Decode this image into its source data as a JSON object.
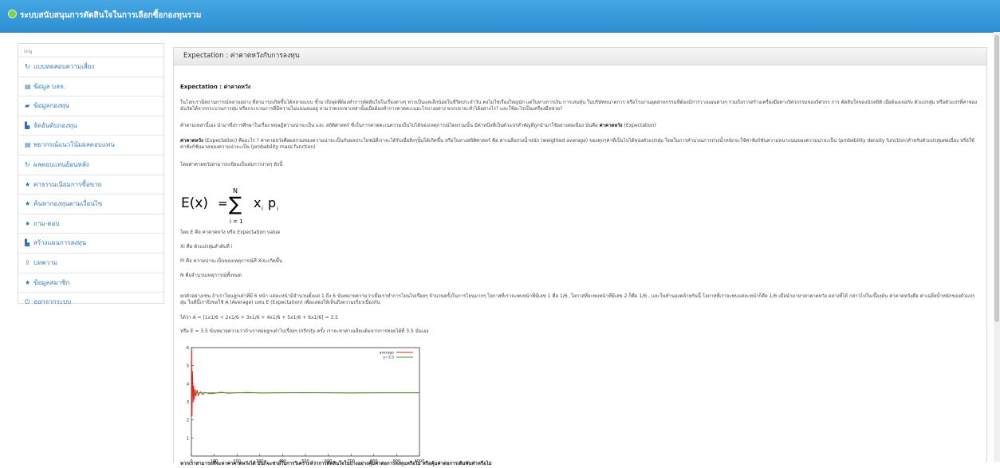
{
  "header": {
    "title": "ระบบสนับสนุนการตัดสินใจในการเลือกซื้อกองทุนรวม"
  },
  "sidebar": {
    "title": "เมนู",
    "items": [
      {
        "icon": "refresh-icon",
        "glyph": "↻",
        "label": "แบบทดสอบความเสี่ยง"
      },
      {
        "icon": "list-icon",
        "glyph": "▤",
        "label": "ข้อมูล บลจ."
      },
      {
        "icon": "folder-icon",
        "glyph": "▰",
        "label": "ข้อมูลกองทุน"
      },
      {
        "icon": "file-icon",
        "glyph": "▙",
        "label": "จัดอันดับกองทุน"
      },
      {
        "icon": "list-icon",
        "glyph": "▤",
        "label": "พยากรณ์แนวโน้มผลตอบแทน"
      },
      {
        "icon": "refresh-icon",
        "glyph": "↻",
        "label": "ผลตอบแทนย้อนหลัง"
      },
      {
        "icon": "star-icon",
        "glyph": "★",
        "label": "ค่าธรรมเนียมการซื้อขาย"
      },
      {
        "icon": "star-icon",
        "glyph": "★",
        "label": "ค้นหากองทุนตามเงื่อนไข"
      },
      {
        "icon": "star-icon",
        "glyph": "★",
        "label": "ถาม-ตอบ"
      },
      {
        "icon": "file-icon",
        "glyph": "▙",
        "label": "สร้างแผนการลงทุน"
      },
      {
        "icon": "upload-icon",
        "glyph": "⇪",
        "label": "บทความ"
      },
      {
        "icon": "star-icon",
        "glyph": "★",
        "label": "ข้อมูลสมาชิก"
      },
      {
        "icon": "power-icon",
        "glyph": "⏻",
        "label": "ออกจากระบบ"
      }
    ]
  },
  "panel": {
    "heading": "Expectation : ค่าคาดหวังกับการลงทุน",
    "section_title": "Expectation : ค่าคาดหวัง",
    "para1": "ในโลกเรามีสถานการณ์หลายอย่าง ที่สามารถเกิดขึ้นได้หลายแบบ ซ้ำมาถึงจุดที่ต้องทำการตัดสินใจในเรื่องต่างๆ หากเป็นแค่เล็กน้อยในชีวิตประจำวัน คงไม่ใช่เรื่องใหญ่นัก แต่ในทางการเงิน การเล่นหุ้น ในบริษัทขนาดการ หรือโรงงานอุตสาหกรรมที่ต้องมีการวางแผนต่างๆ รวมถึงการสร้างเครื่องมือทางวิศวกรรมของวิศวกร การ ตัดสินใจของนักสถิติ เมื่อต้องเจอกับ ตัวแปรสุ่ม หรือตัวแปรที่ค่าของมันวัดได้จากกระบวนการสุ่ม หรือกระบวนการที่มีความไม่แน่นอนอยู่ ถามว่าพวกเขาเหล่านั้นเมื่อต้องทำการคาดคะเนอะไรบางอย่าง พวกเขาจะทำได้อย่างไร? และใช้อะไรเป็นเครื่องมือช่วย?",
    "para2_text": "คำตามเหล่านี้เอง นำมาซึ่งการศึกษาในเรื่อง ทฤษฎีความน่าจะเป็น และ สถิติศาสตร์ ซึ่งในการคาดคะเนความเป็นไปได้ของเหตุการณ์โดยรวมนั้น มีค่าหนึ่งที่เป็นตัวแปรสำคัญที่ถูกนำมาใช้อย่างต่อเนื่อง นั่นคือ",
    "para2_bold": "ค่าคาดหวัง",
    "para2_tail": "(Expectation)",
    "para3_bold": "ค่าคาดหวัง",
    "para3_text": "(Expectation) คืออะไร ? ค่าคาดหวังคือผลรวมของความน่าจะเป็นกับผลประโยชน์ที่เราจะได้รับเมื่อสิ่งๆนั้นได้เกิดขึ้น หรือในทางสถิติศาสตร์ คือ ค่าเฉลี่ยถ่วงน้ำหนัก (weighted average) ของทุกๆค่าที่เป็นไปได้ของตัวแปรสุ่ม โดยในการคำนวณการถ่วงน้ำหนักจะใช้ค่าฟังก์ชันความหนาแน่นของความน่าจะเป็น (probability density function)สำหรับตัวแปรสุ่มต่อเนื่อง หรือใช้ค่าฟังก์ชันมวลของความน่าจะเป็น (probability mass function)",
    "para4": "โดยค่าคาดหวังสามารถเขียนเป็นสมการง่ายๆ ดังนี้",
    "formula": {
      "lhs": "E(x)",
      "eq": "=",
      "sigma": "∑",
      "top": "N",
      "bottom": "i = 1",
      "x": "x",
      "xi": "i",
      "p": "p",
      "pi": "i"
    },
    "defs": [
      "โดย E คือ ค่าคาดหวัง หรือ Expectation value",
      "Xi คือ ตัวแปรสุ่มลำดับที่ i",
      "Pi คือ ความน่าจะเป็นของเหตุการณ์ที่ Xiจะเกิดขึ้น",
      "N คือจำนวนเหตุการณ์ทั้งหมด"
    ],
    "example": "ยกตัวอย่างเช่น ถ้าเราโยนลูกเต๋าที่มี 6 หน้า แต่ละหน้ามีจำนวนตั้งแต่ 1 ถึง 6 นั่นหมายความว่าเมื่อเราทำการโยนไปเรื่อยๆ จำนวนครั้งในการโยนมากๆ โอกาสที่เราจะพบหน้าที่มีเลข 1 คือ 1/6 ,โอกาสที่จะพบหน้าที่มีเลข 2 ก็คือ 1/6 , และในทำนองคล้ายกันนี้ โอกาสที่เราจะพบแต่ละหน้าก็คือ 1/6 เมื่อนำมาหาค่าคาดหวัง อย่างที่ได้ กล่าวไปในเบื้องต้น ค่าคาดหวังคือ ค่าเฉลี่ยน้ำหนักของตัวแปรสุ่ม ในที่นี้เราจึงขอใช้ A (Average) แทน E (Expectation) เพื่อแสดงให้เห็นถึงความเกี่ยวเนื่องกัน",
    "calc1": "ได้ว่า A = [1x1/6 + 2x1/6 + 3x1/6 + 4x1/6 + 5x1/6 + 6x1/6] = 3.5",
    "calc2": "หรือ E = 3.5 นั่นหมายความว่าถ้าเราทอยลูกเต๋าไปเรื่อยๆ infinity ครั้ง เราจะหาค่าเฉลี่ยแต้มจากการทอยได้ที่ 3.5 นั่นเอง",
    "closing": "หากเราสามารถที่จะหาค่าคาดหวังได้ มันก็จะช่วยในการวิเคราะห์ว่าการตัดสินใจในบางอย่างคุ้มค่าต่อการลงทุนหรือไม่ หรือคุ้มค่าต่อการเดิมพันทำหรือไม่"
  },
  "chart_data": {
    "type": "line",
    "legend": "top-right",
    "xlim": [
      0,
      1000
    ],
    "ylim": [
      0,
      6
    ],
    "xticks": [
      "0",
      "100",
      "200",
      "300",
      "400",
      "500",
      "600",
      "700",
      "800",
      "900",
      "1000"
    ],
    "yticks": [
      "1",
      "2",
      "3",
      "4",
      "5",
      "6"
    ],
    "series": [
      {
        "name": "average",
        "color": "#e0201c",
        "x": [
          1,
          3,
          5,
          8,
          10,
          13,
          16,
          20,
          25,
          30,
          40,
          50,
          60,
          80,
          100,
          130,
          160,
          200,
          250,
          300,
          400,
          500,
          600,
          700,
          800,
          900,
          1000
        ],
        "y": [
          5.9,
          2.2,
          4.7,
          3.0,
          3.9,
          3.1,
          3.7,
          3.3,
          3.65,
          3.35,
          3.55,
          3.4,
          3.52,
          3.45,
          3.47,
          3.53,
          3.48,
          3.5,
          3.52,
          3.49,
          3.5,
          3.51,
          3.5,
          3.49,
          3.5,
          3.5,
          3.5
        ]
      },
      {
        "name": "y=3.5",
        "color": "#2ca02c",
        "x": [
          0,
          1000
        ],
        "y": [
          3.5,
          3.5
        ]
      }
    ]
  }
}
